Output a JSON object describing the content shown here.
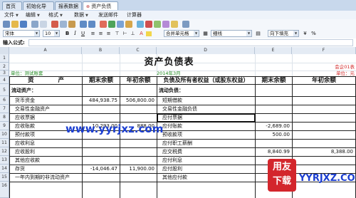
{
  "tabs": [
    {
      "label": "首页"
    },
    {
      "label": "初始化导航"
    },
    {
      "label": "报表数据"
    },
    {
      "label": "资产负债表"
    }
  ],
  "menu": [
    {
      "label": "文件"
    },
    {
      "label": "编辑"
    },
    {
      "label": "格式"
    },
    {
      "label": "数据"
    },
    {
      "label": "发送邮件"
    },
    {
      "label": "计算器"
    }
  ],
  "format_toolbar": {
    "font_name": "宋体",
    "font_size": "10",
    "bold": "B",
    "italic": "I",
    "underline": "U",
    "merge_label": "合并单元格",
    "border_label": "细线",
    "fill_label": "向下填充",
    "percent": "%"
  },
  "formula_bar": {
    "label": "输入公式:",
    "value": ""
  },
  "columns": [
    "A",
    "B",
    "C",
    "D",
    "E",
    "F"
  ],
  "rows": [
    "1",
    "2",
    "3",
    "4",
    "5",
    "6",
    "7",
    "8",
    "9",
    "10",
    "11",
    "12",
    "13",
    "14",
    "15",
    "16"
  ],
  "sheet": {
    "title": "资产负债表",
    "meta_right_1": "会企01表",
    "unit_left": "单位：测试账套",
    "period": "2014年3月",
    "unit_right": "单位：元",
    "hdr_asset": "资　　　　产",
    "hdr_end": "期末余额",
    "hdr_begin": "年初余额",
    "hdr_liab": "负债及所有者权益（或股东权益）",
    "hdr_end2": "期末余额",
    "hdr_begin2": "年初余额",
    "rows": [
      {
        "a": "流动资产：",
        "b": "",
        "c": "",
        "d": "流动负债：",
        "e": "",
        "f": ""
      },
      {
        "a": "货币资金",
        "b": "484,938.75",
        "c": "506,800.00",
        "d": "短期借款",
        "e": "",
        "f": ""
      },
      {
        "a": "交易性金融资产",
        "b": "",
        "c": "",
        "d": "交易性金融负债",
        "e": "",
        "f": ""
      },
      {
        "a": "应收票据",
        "b": "",
        "c": "",
        "d": "应付票据",
        "e": "",
        "f": ""
      },
      {
        "a": "应收账款",
        "b": "10,293.00",
        "c": "888.00",
        "d": "应付账款",
        "e": "-2,689.00",
        "f": ""
      },
      {
        "a": "预付款项",
        "b": "",
        "c": "",
        "d": "预收款项",
        "e": "500.00",
        "f": ""
      },
      {
        "a": "应收利息",
        "b": "",
        "c": "",
        "d": "应付职工薪酬",
        "e": "",
        "f": ""
      },
      {
        "a": "应收股利",
        "b": "",
        "c": "",
        "d": "应交税费",
        "e": "8,840.99",
        "f": "8,388.00"
      },
      {
        "a": "其他应收款",
        "b": "",
        "c": "",
        "d": "应付利息",
        "e": "",
        "f": ""
      },
      {
        "a": "存货",
        "b": "-14,046.47",
        "c": "11,900.00",
        "d": "应付股利",
        "e": "",
        "f": ""
      },
      {
        "a": "一年内到期的非流动资产",
        "b": "",
        "c": "",
        "d": "其他应付款",
        "e": "",
        "f": ""
      }
    ]
  },
  "watermark": {
    "url": "www.yyrjxz.com",
    "badge_top": "用友",
    "badge_bottom": "下载",
    "brand": "YYRJXZ.COM"
  },
  "colors": {
    "green_text": "#208a20",
    "red_text": "#d22828",
    "watermark_blue": "#1c3fd1",
    "badge_red": "#d3262c"
  }
}
